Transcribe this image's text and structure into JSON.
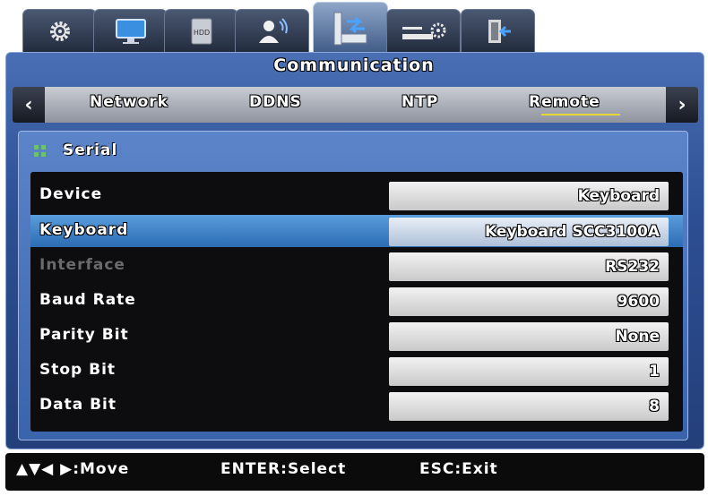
{
  "icon_tabs": [
    {
      "name": "gear-icon"
    },
    {
      "name": "monitor-icon"
    },
    {
      "name": "hdd-icon",
      "label": "HDD"
    },
    {
      "name": "user-icon"
    },
    {
      "name": "network-icon"
    },
    {
      "name": "device-settings-icon"
    },
    {
      "name": "exit-icon"
    }
  ],
  "panel": {
    "title": "Communication"
  },
  "subtabs": [
    "Network",
    "DDNS",
    "NTP",
    "Remote"
  ],
  "active_subtab": "Remote",
  "section": {
    "title": "Serial"
  },
  "rows": [
    {
      "label": "Device",
      "value": "Keyboard"
    },
    {
      "label": "Keyboard",
      "value": "Keyboard SCC3100A",
      "selected": true
    },
    {
      "label": "Interface",
      "value": "RS232",
      "disabled": true
    },
    {
      "label": "Baud Rate",
      "value": "9600"
    },
    {
      "label": "Parity Bit",
      "value": "None"
    },
    {
      "label": "Stop Bit",
      "value": "1"
    },
    {
      "label": "Data Bit",
      "value": "8"
    }
  ],
  "footer": {
    "move": "▲▼◀ ▶:Move",
    "select": "ENTER:Select",
    "exit": "ESC:Exit"
  },
  "colors": {
    "accent_underline": "#e7d63a",
    "selection": "#2b6cb3",
    "panel": "#2d4f93"
  }
}
